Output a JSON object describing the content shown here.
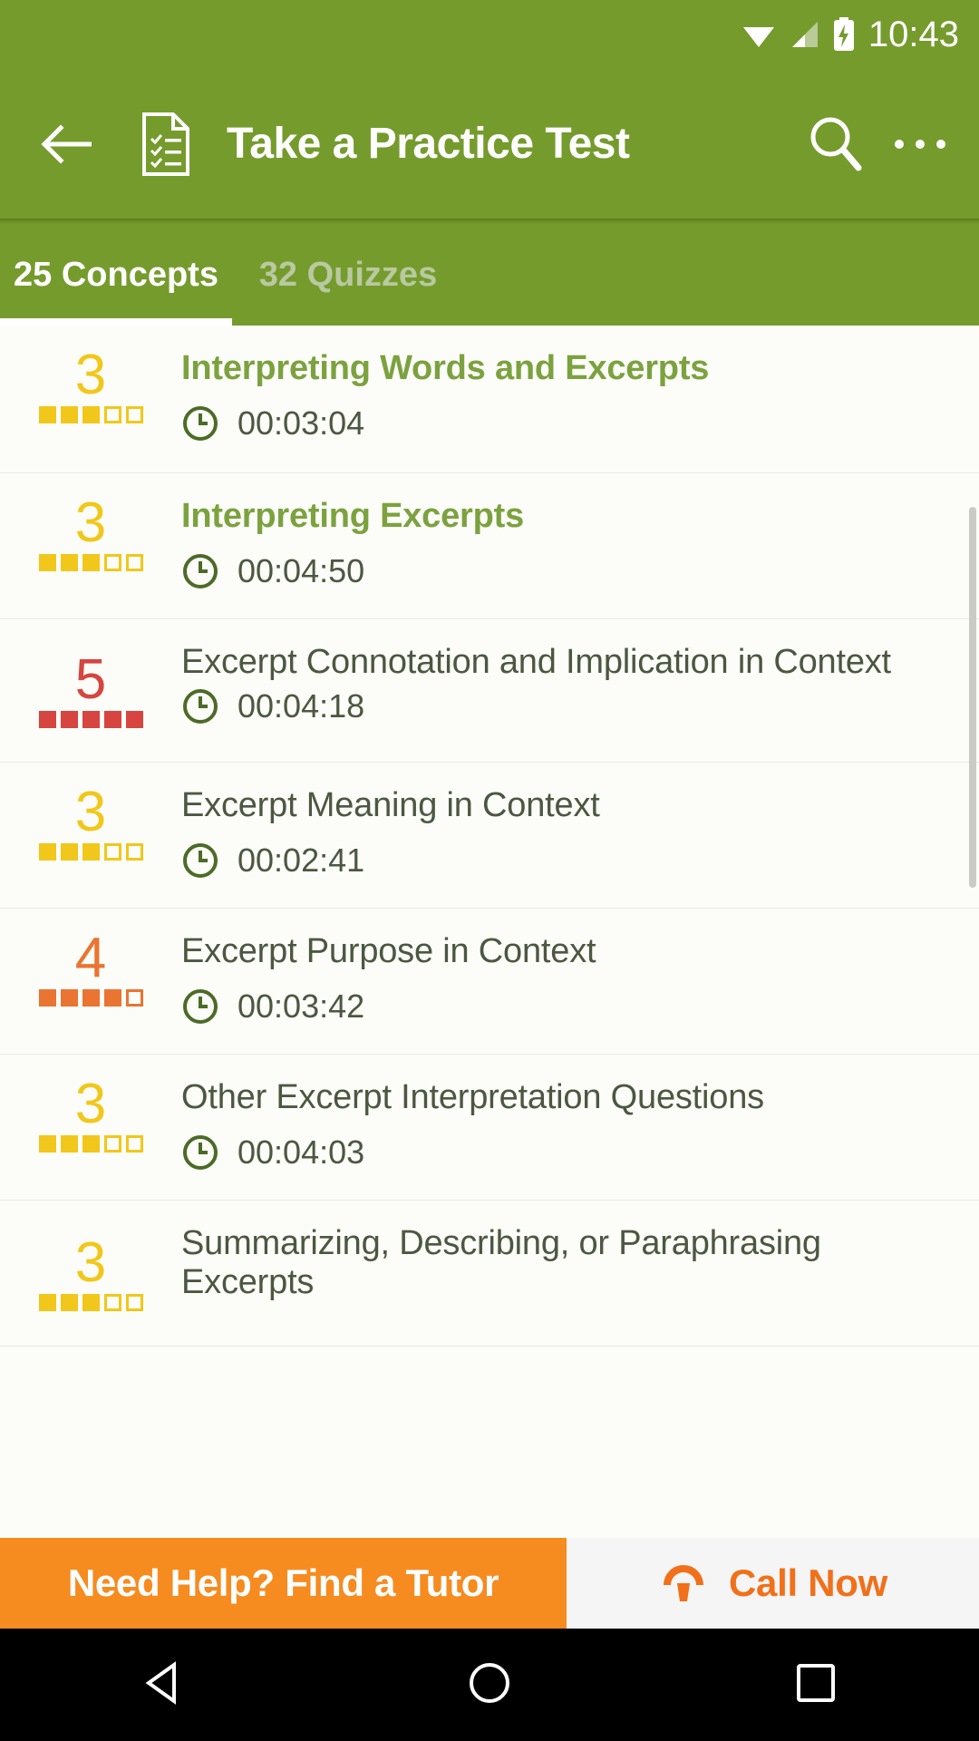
{
  "status_bar": {
    "time": "10:43",
    "icons": [
      "wifi-icon",
      "cell-signal-icon",
      "battery-charging-icon"
    ]
  },
  "app_bar": {
    "back_icon": "arrow-left-icon",
    "leading_icon": "practice-test-document-icon",
    "title": "Take a Practice Test",
    "search_icon": "search-icon",
    "overflow_icon": "more-vertical-icon"
  },
  "tabs": [
    {
      "label": "25 Concepts",
      "active": true
    },
    {
      "label": "32 Quizzes",
      "active": false
    }
  ],
  "colors": {
    "primary_green": "#759B2D",
    "title_green": "#7BA23F",
    "text_dark": "#4C5741",
    "yellow": "#F2C71B",
    "red": "#D6453F",
    "orange": "#EA7432",
    "banner_orange": "#F68B1F",
    "call_orange": "#F1701A"
  },
  "list": {
    "rows": [
      {
        "score": "3",
        "score_color": "#F2C71B",
        "filled": 3,
        "total": 5,
        "title": "Interpreting Words and Excerpts",
        "title_bold": true,
        "time": "00:03:04",
        "clock_icon": "clock-icon"
      },
      {
        "score": "3",
        "score_color": "#F2C71B",
        "filled": 3,
        "total": 5,
        "title": "Interpreting Excerpts",
        "title_bold": true,
        "time": "00:04:50",
        "clock_icon": "clock-icon"
      },
      {
        "score": "5",
        "score_color": "#D6453F",
        "filled": 5,
        "total": 5,
        "title": "Excerpt Connotation and Implication in Context",
        "title_bold": false,
        "time": "00:04:18",
        "clock_icon": "clock-icon"
      },
      {
        "score": "3",
        "score_color": "#F2C71B",
        "filled": 3,
        "total": 5,
        "title": "Excerpt Meaning in Context",
        "title_bold": false,
        "time": "00:02:41",
        "clock_icon": "clock-icon"
      },
      {
        "score": "4",
        "score_color": "#EA7432",
        "filled": 4,
        "total": 5,
        "title": "Excerpt Purpose in Context",
        "title_bold": false,
        "time": "00:03:42",
        "clock_icon": "clock-icon"
      },
      {
        "score": "3",
        "score_color": "#F2C71B",
        "filled": 3,
        "total": 5,
        "title": "Other Excerpt Interpretation Questions",
        "title_bold": false,
        "time": "00:04:03",
        "clock_icon": "clock-icon"
      },
      {
        "score": "3",
        "score_color": "#F2C71B",
        "filled": 3,
        "total": 5,
        "title": "Summarizing, Describing, or Paraphrasing Excerpts",
        "title_bold": false,
        "time": "",
        "clock_icon": "clock-icon"
      }
    ]
  },
  "banner": {
    "headline": "Need Help? Find a Tutor",
    "call_label": "Call Now",
    "phone_icon": "phone-icon"
  },
  "nav_bar": {
    "back_icon": "triangle-back-icon",
    "home_icon": "circle-home-icon",
    "recents_icon": "square-recents-icon"
  }
}
